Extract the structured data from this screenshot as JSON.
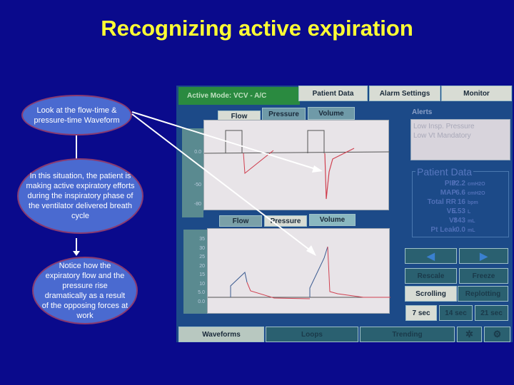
{
  "title": "Recognizing active expiration",
  "callouts": [
    "Look at the flow-time & pressure-time Waveform",
    "In this situation, the patient is making active expiratory efforts during the inspiratory phase of the ventilator delivered breath cycle",
    "Notice how the expiratory flow and the pressure rise dramatically as a result of the opposing forces at work"
  ],
  "ventilator": {
    "active_mode": "Active Mode:  VCV - A/C",
    "top_tabs": [
      "Patient Data",
      "Alarm Settings",
      "Monitor"
    ],
    "waveform_tabs": [
      "Flow",
      "Pressure",
      "Volume"
    ],
    "flow_axis": [
      "0.0",
      "-50",
      "-80"
    ],
    "pressure_axis": [
      "35",
      "30",
      "25",
      "20",
      "15",
      "10",
      "5.0",
      "0.0"
    ],
    "alerts_label": "Alerts",
    "alerts": [
      "Low Insp. Pressure",
      "Low Vt Mandatory"
    ],
    "patient_data_label": "Patient Data",
    "patient_data": [
      {
        "label": "PIP",
        "value": "32.2",
        "unit": "cmH2O"
      },
      {
        "label": "MAP",
        "value": "6.6",
        "unit": "cmH2O"
      },
      {
        "label": "Total RR",
        "value": "16",
        "unit": "bpm"
      },
      {
        "label": "VE",
        "value": "5.53",
        "unit": "L"
      },
      {
        "label": "Vt",
        "value": "343",
        "unit": "mL"
      },
      {
        "label": "Pt Leak",
        "value": "0.0",
        "unit": "mL"
      }
    ],
    "controls": {
      "rescale": "Rescale",
      "freeze": "Freeze",
      "scrolling": "Scrolling",
      "replotting": "Replotting",
      "times": [
        "7 sec",
        "14 sec",
        "21 sec"
      ]
    },
    "bottom_tabs": [
      "Waveforms",
      "Loops",
      "Trending"
    ]
  },
  "colors": {
    "background": "#0a0a8c",
    "title": "#ffff33",
    "callout": "#4a6ad0"
  }
}
